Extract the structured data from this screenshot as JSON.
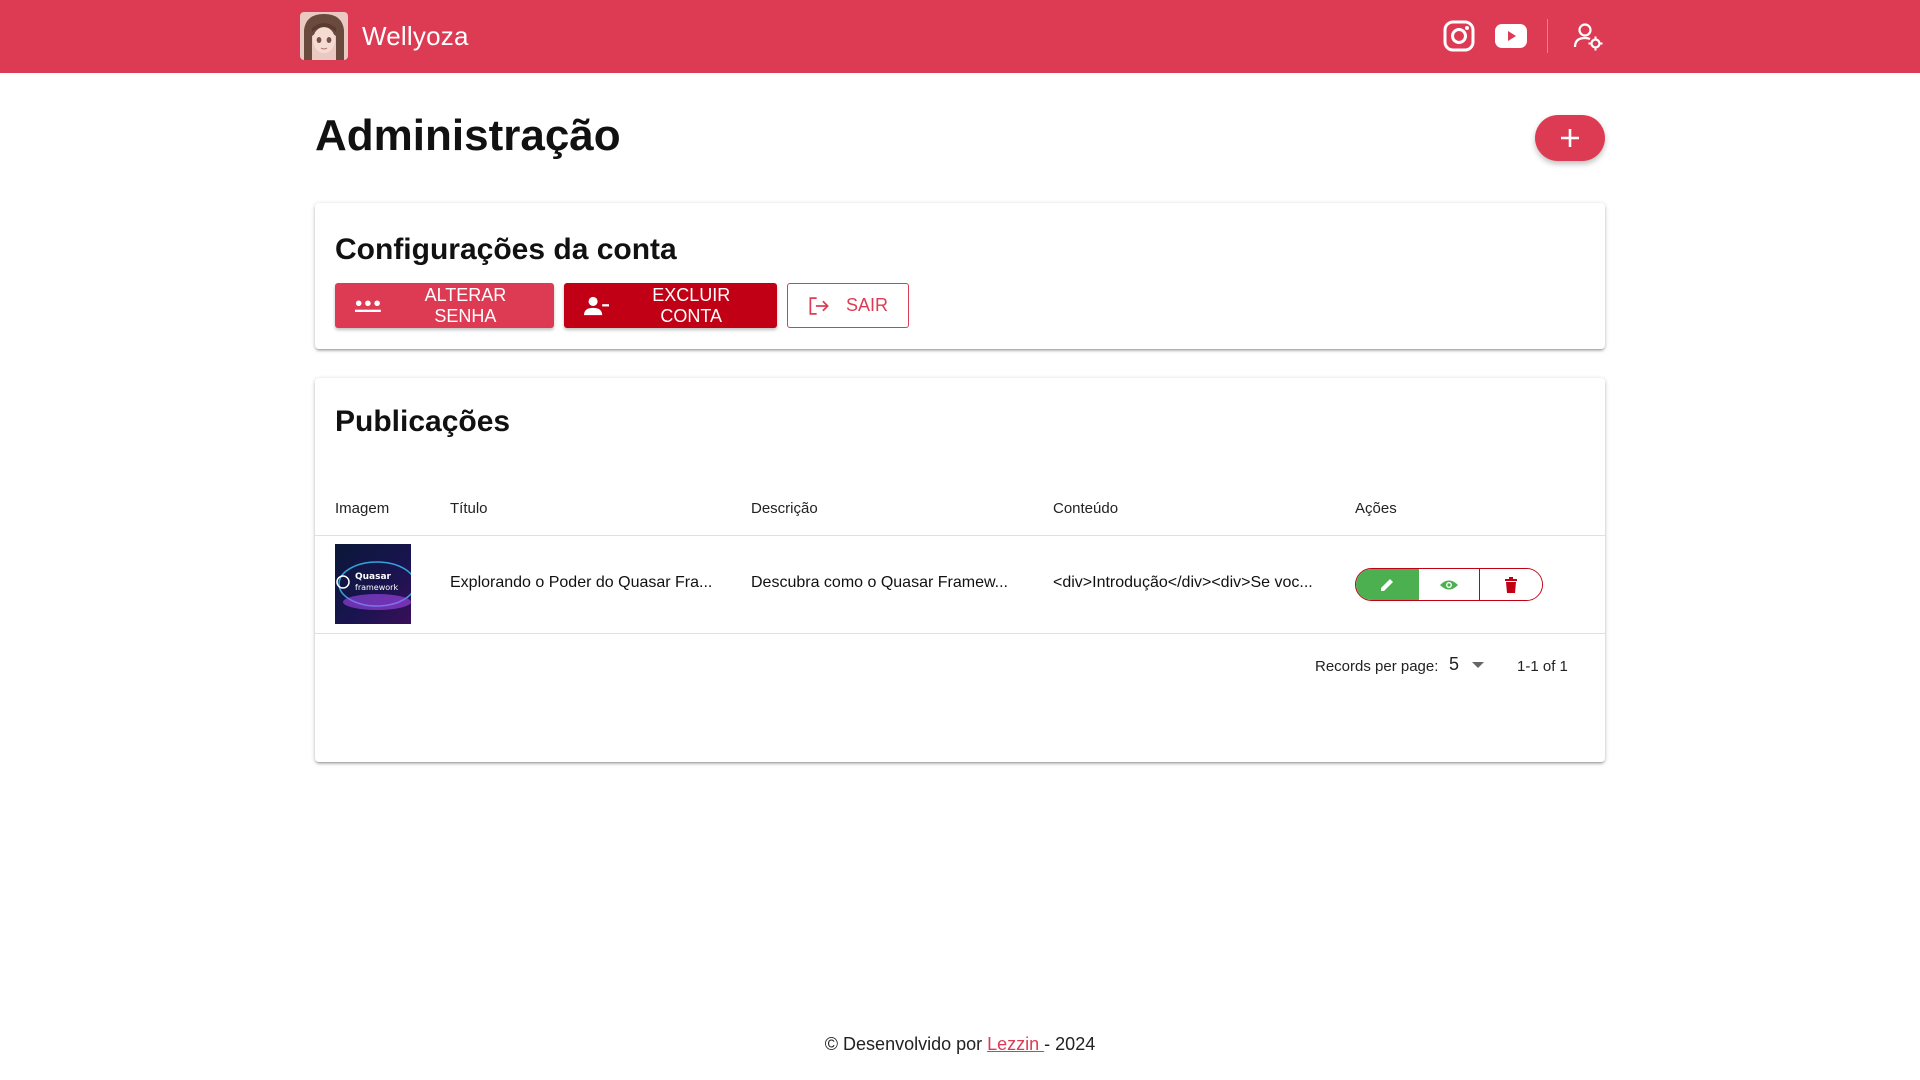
{
  "header": {
    "brand_name": "Wellyoza",
    "brand_color": "#dd3b53",
    "icons": [
      "instagram-icon",
      "youtube-icon",
      "account-settings-icon"
    ]
  },
  "page": {
    "title": "Administração"
  },
  "account_card": {
    "title": "Configurações da conta",
    "change_password_label": "ALTERAR SENHA",
    "delete_account_label": "EXCLUIR CONTA",
    "logout_label": "SAIR"
  },
  "publications": {
    "title": "Publicações",
    "columns": [
      "Imagem",
      "Título",
      "Descrição",
      "Conteúdo",
      "Ações"
    ],
    "rows": [
      {
        "thumb_text_1": "Quasar",
        "thumb_text_2": "framework",
        "title": "Explorando o Poder do Quasar Fra...",
        "description": "Descubra como o Quasar Framew...",
        "content": "<div>Introdução</div><div>Se voc..."
      }
    ],
    "records_per_page_label": "Records per page:",
    "records_per_page_value": "5",
    "pagination": "1-1 of 1"
  },
  "footer": {
    "prefix": "© Desenvolvido por ",
    "author": "Lezzin ",
    "suffix": "- 2024"
  },
  "colors": {
    "accent": "#dd3b53",
    "negative": "#c10015",
    "positive": "#4caf50"
  }
}
